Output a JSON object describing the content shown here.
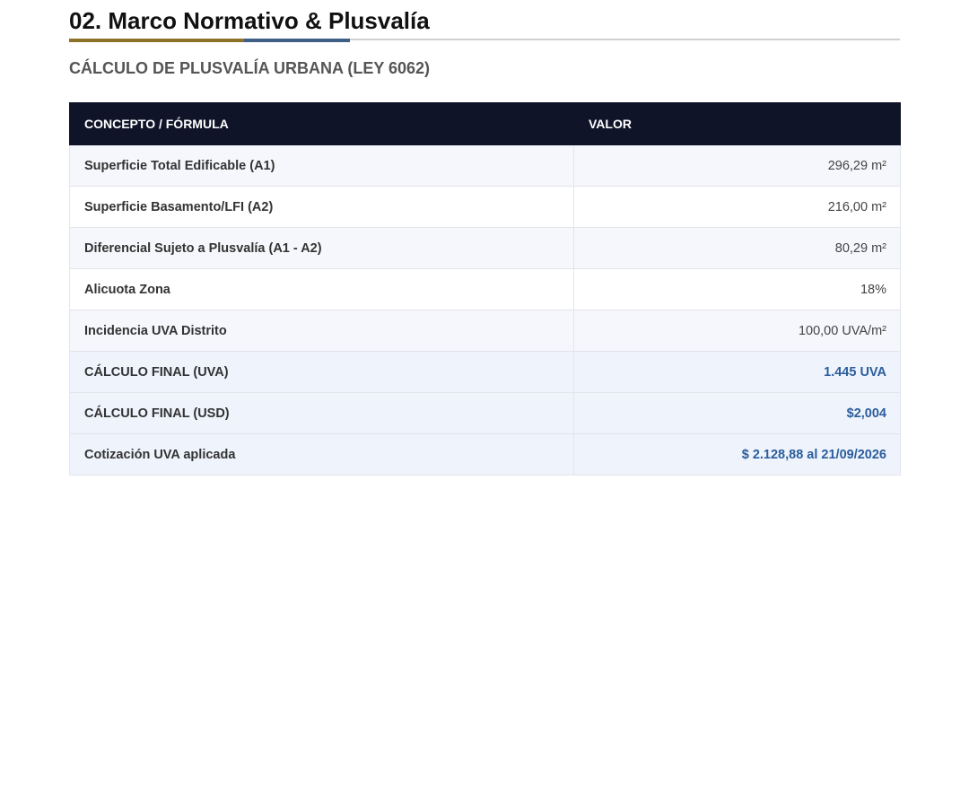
{
  "section": {
    "title": "02. Marco Normativo & Plusvalía",
    "subtitle": "CÁLCULO DE PLUSVALÍA URBANA (LEY 6062)"
  },
  "accent_colors": {
    "gold": "#8c7228",
    "blue": "#3f5f86",
    "header_bg": "#0f1428",
    "result_text": "#2b5d9c"
  },
  "table": {
    "headers": [
      "CONCEPTO / FÓRMULA",
      "VALOR"
    ],
    "rows": [
      {
        "concept": "Superficie Total Edificable (A1)",
        "value": "296,29 m²"
      },
      {
        "concept": "Superficie Basamento/LFI (A2)",
        "value": "216,00 m²"
      },
      {
        "concept": "Diferencial Sujeto a Plusvalía (A1 - A2)",
        "value": "80,29 m²"
      },
      {
        "concept": "Alicuota Zona",
        "value": "18%"
      },
      {
        "concept": "Incidencia UVA Distrito",
        "value": "100,00 UVA/m²"
      }
    ],
    "results": [
      {
        "concept": "CÁLCULO FINAL (UVA)",
        "value": "1.445 UVA"
      },
      {
        "concept": "CÁLCULO FINAL (USD)",
        "value": "$2,004"
      },
      {
        "concept": "Cotización UVA aplicada",
        "value": "$ 2.128,88 al 21/09/2026"
      }
    ]
  }
}
